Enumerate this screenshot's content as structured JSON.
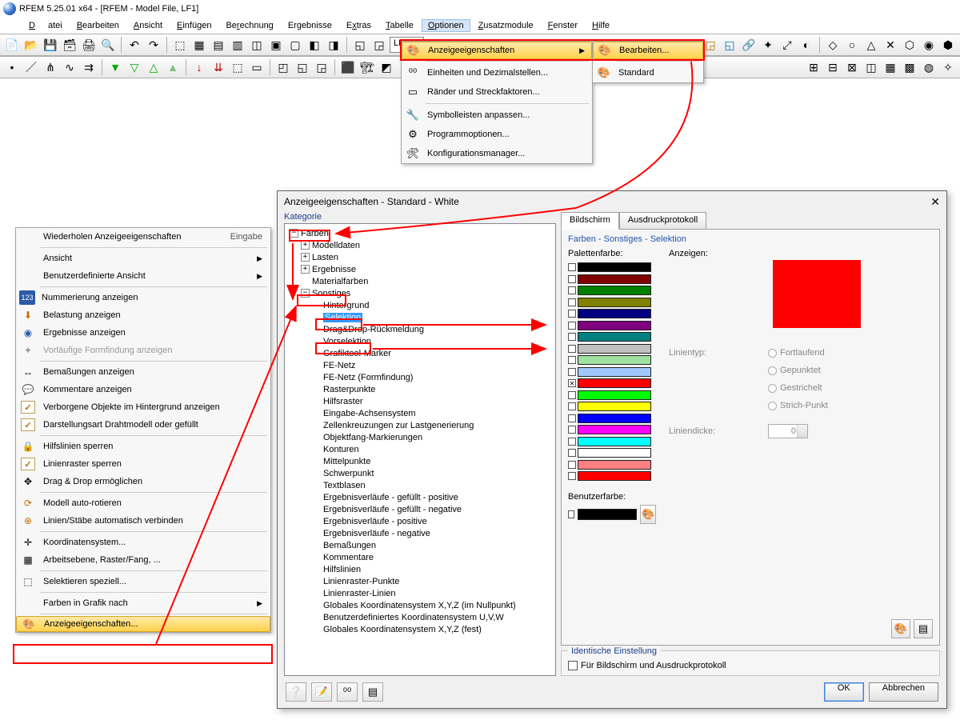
{
  "title": "RFEM 5.25.01 x64 - [RFEM - Model File, LF1]",
  "menubar": [
    "Datei",
    "Bearbeiten",
    "Ansicht",
    "Einfügen",
    "Berechnung",
    "Ergebnisse",
    "Extras",
    "Tabelle",
    "Optionen",
    "Zusatzmodule",
    "Fenster",
    "Hilfe"
  ],
  "menubar_active_index": 8,
  "toolbar": {
    "lf_label": "LF1"
  },
  "options_menu": {
    "anzeige": "Anzeigeeigenschaften",
    "einheiten": "Einheiten und Dezimalstellen...",
    "raender": "Ränder und Streckfaktoren...",
    "symbolleisten": "Symbolleisten anpassen...",
    "programm": "Programmoptionen...",
    "konfig": "Konfigurationsmanager..."
  },
  "options_submenu": {
    "bearbeiten": "Bearbeiten...",
    "standard": "Standard"
  },
  "context": {
    "wiederholen": "Wiederholen Anzeigeeigenschaften",
    "eingabe": "Eingabe",
    "ansicht": "Ansicht",
    "benutz": "Benutzerdefinierte Ansicht",
    "nummer": "Nummerierung anzeigen",
    "belastung": "Belastung anzeigen",
    "ergebnisse": "Ergebnisse anzeigen",
    "formfindung": "Vorläufige Formfindung anzeigen",
    "bemass": "Bemaßungen anzeigen",
    "kommentare": "Kommentare anzeigen",
    "verborgene": "Verborgene Objekte im Hintergrund anzeigen",
    "darstell": "Darstellungsart Drahtmodell oder gefüllt",
    "hilfs_sperr": "Hilfslinien sperren",
    "raster_sperr": "Linienraster sperren",
    "dragdrop": "Drag & Drop ermöglichen",
    "autorot": "Modell auto-rotieren",
    "autoverb": "Linien/Stäbe automatisch verbinden",
    "koord": "Koordinatensystem...",
    "arbeitsebene": "Arbeitsebene, Raster/Fang, ...",
    "selekt": "Selektieren speziell...",
    "farben": "Farben in Grafik nach",
    "anzeigeeig": "Anzeigeeigenschaften..."
  },
  "dialog": {
    "title": "Anzeigeeigenschaften - Standard - White",
    "kategorie_label": "Kategorie",
    "tree": {
      "farben": "Farben",
      "modelldaten": "Modelldaten",
      "lasten": "Lasten",
      "ergebnisse": "Ergebnisse",
      "materialfarben": "Materialfarben",
      "sonstiges": "Sonstiges",
      "items": [
        "Hintergrund",
        "Selektion",
        "Drag&Drop-Rückmeldung",
        "Vorselektion",
        "Grafiktool-Marker",
        "FE-Netz",
        "FE-Netz (Formfindung)",
        "Rasterpunkte",
        "Hilfsraster",
        "Eingabe-Achsensystem",
        "Zellenkreuzungen zur Lastgenerierung",
        "Objektfang-Markierungen",
        "Konturen",
        "Mittelpunkte",
        "Schwerpunkt",
        "Textblasen",
        "Ergebnisverläufe - gefüllt - positive",
        "Ergebnisverläufe - gefüllt - negative",
        "Ergebnisverläufe - positive",
        "Ergebnisverläufe - negative",
        "Bemaßungen",
        "Kommentare",
        "Hilfslinien",
        "Linienraster-Punkte",
        "Linienraster-Linien",
        "Globales Koordinatensystem X,Y,Z (im Nullpunkt)",
        "Benutzerdefiniertes Koordinatensystem U,V,W",
        "Globales Koordinatensystem X,Y,Z (fest)"
      ],
      "selected_index": 1,
      "boxed_index": 3
    },
    "tabs": {
      "bildschirm": "Bildschirm",
      "ausdruck": "Ausdruckprotokoll"
    },
    "breadcrumb": "Farben - Sonstiges - Selektion",
    "labels": {
      "palettenfarbe": "Palettenfarbe:",
      "anzeigen": "Anzeigen:",
      "linientyp": "Linientyp:",
      "liniendicke": "Liniendicke:",
      "benutzerfarbe": "Benutzerfarbe:",
      "ident_group": "Identische Einstellung",
      "ident_check": "Für Bildschirm und Ausdruckprotokoll"
    },
    "linetype_opts": [
      "Fortlaufend",
      "Gepunktet",
      "Gestrichelt",
      "Strich-Punkt"
    ],
    "liniendicke_value": "0",
    "palette": [
      "#000000",
      "#800000",
      "#008000",
      "#808000",
      "#000080",
      "#800080",
      "#008080",
      "#c0c0c0",
      "#a0e0a0",
      "#a0c8ff",
      "#ff0000",
      "#00ff00",
      "#ffff00",
      "#0000ff",
      "#ff00ff",
      "#00ffff",
      "#ffffff",
      "#ff8080",
      "#ff0000"
    ],
    "palette_checked_index": 10,
    "preview_color": "#ff0000",
    "user_color": "#000000",
    "buttons": {
      "ok": "OK",
      "abbrechen": "Abbrechen"
    }
  }
}
